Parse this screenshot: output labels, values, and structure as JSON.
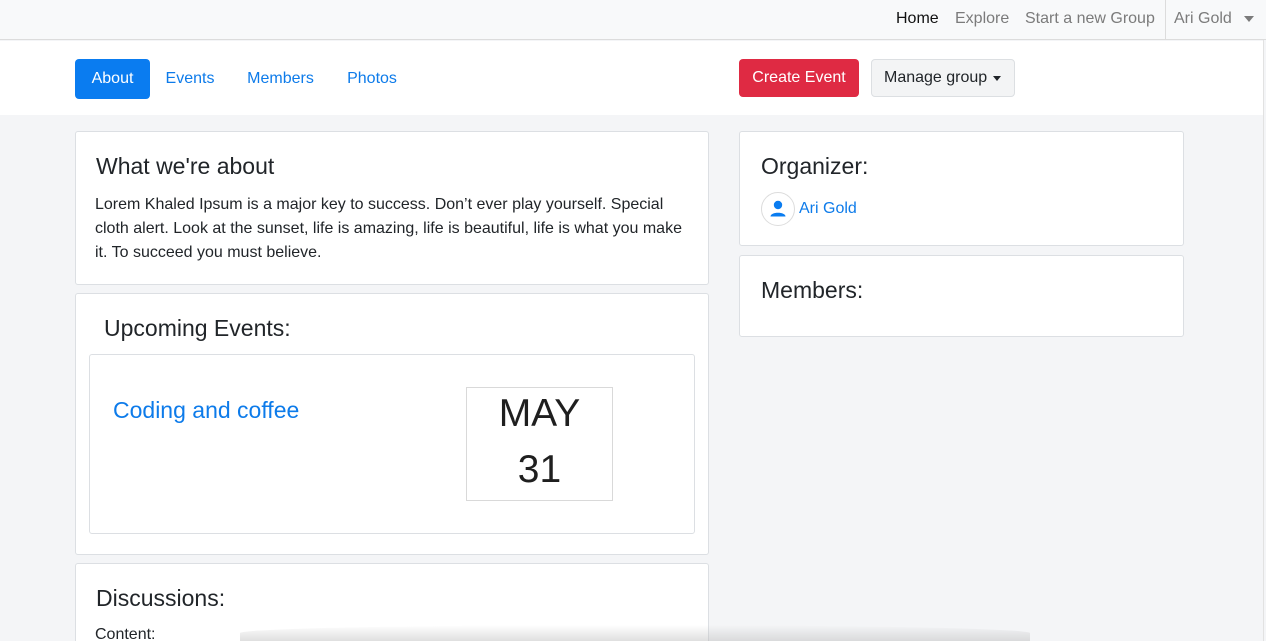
{
  "topnav": {
    "links": [
      {
        "label": "Home",
        "active": true
      },
      {
        "label": "Explore",
        "active": false
      },
      {
        "label": "Start a new Group",
        "active": false
      }
    ],
    "user_menu": {
      "label": "Ari Gold",
      "icon": "chevron-down-icon"
    }
  },
  "subnav": {
    "tabs": [
      {
        "label": "About",
        "active": true
      },
      {
        "label": "Events",
        "active": false
      },
      {
        "label": "Members",
        "active": false
      },
      {
        "label": "Photos",
        "active": false
      }
    ],
    "create_event_label": "Create Event",
    "manage_group_label": "Manage group"
  },
  "about": {
    "title": "What we're about",
    "text": "Lorem Khaled Ipsum is a major key to success. Don’t ever play yourself. Special cloth alert. Look at the sunset, life is amazing, life is beautiful, life is what you make it. To succeed you must believe."
  },
  "upcoming": {
    "title": "Upcoming Events:",
    "events": [
      {
        "name": "Coding and coffee",
        "month": "MAY",
        "day": "31"
      }
    ]
  },
  "discussions": {
    "title": "Discussions:",
    "content_label": "Content:"
  },
  "organizer": {
    "title": "Organizer:",
    "name": "Ari Gold",
    "avatar_icon": "user-icon"
  },
  "members": {
    "title": "Members:"
  },
  "colors": {
    "primary": "#0a7cf0",
    "danger": "#df2a43",
    "link": "#0d7bea",
    "page_background": "#f4f5f7"
  }
}
